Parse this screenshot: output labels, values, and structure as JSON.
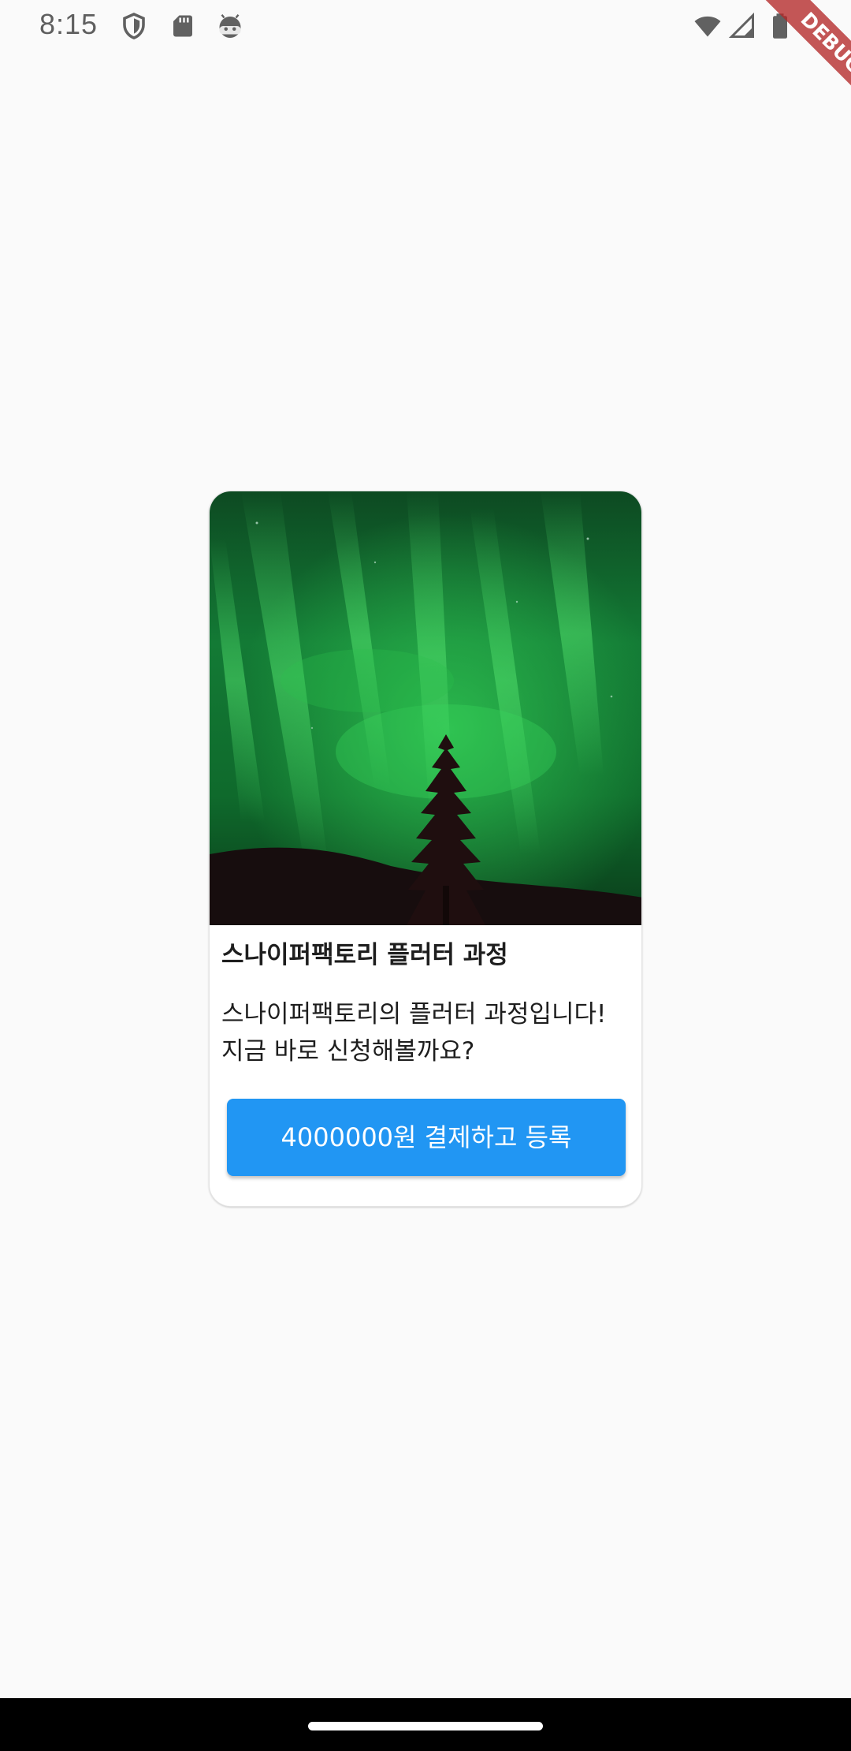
{
  "status_bar": {
    "time": "8:15",
    "icons_left": [
      "shield-icon",
      "sd-card-icon",
      "android-face-icon"
    ],
    "icons_right": [
      "wifi-icon",
      "cell-signal-icon",
      "battery-icon"
    ]
  },
  "debug_banner": {
    "label": "DEBUG"
  },
  "card": {
    "image": "aurora-tree-image",
    "title": "스나이퍼팩토리 플러터 과정",
    "description": "스나이퍼팩토리의 플러터 과정입니다! 지금 바로 신청해볼까요?",
    "button_label": "4000000원 결제하고 등록"
  },
  "colors": {
    "background": "#fafafa",
    "button": "#2196f3",
    "debug_ribbon": "#b42828",
    "nav_bar": "#000000"
  }
}
